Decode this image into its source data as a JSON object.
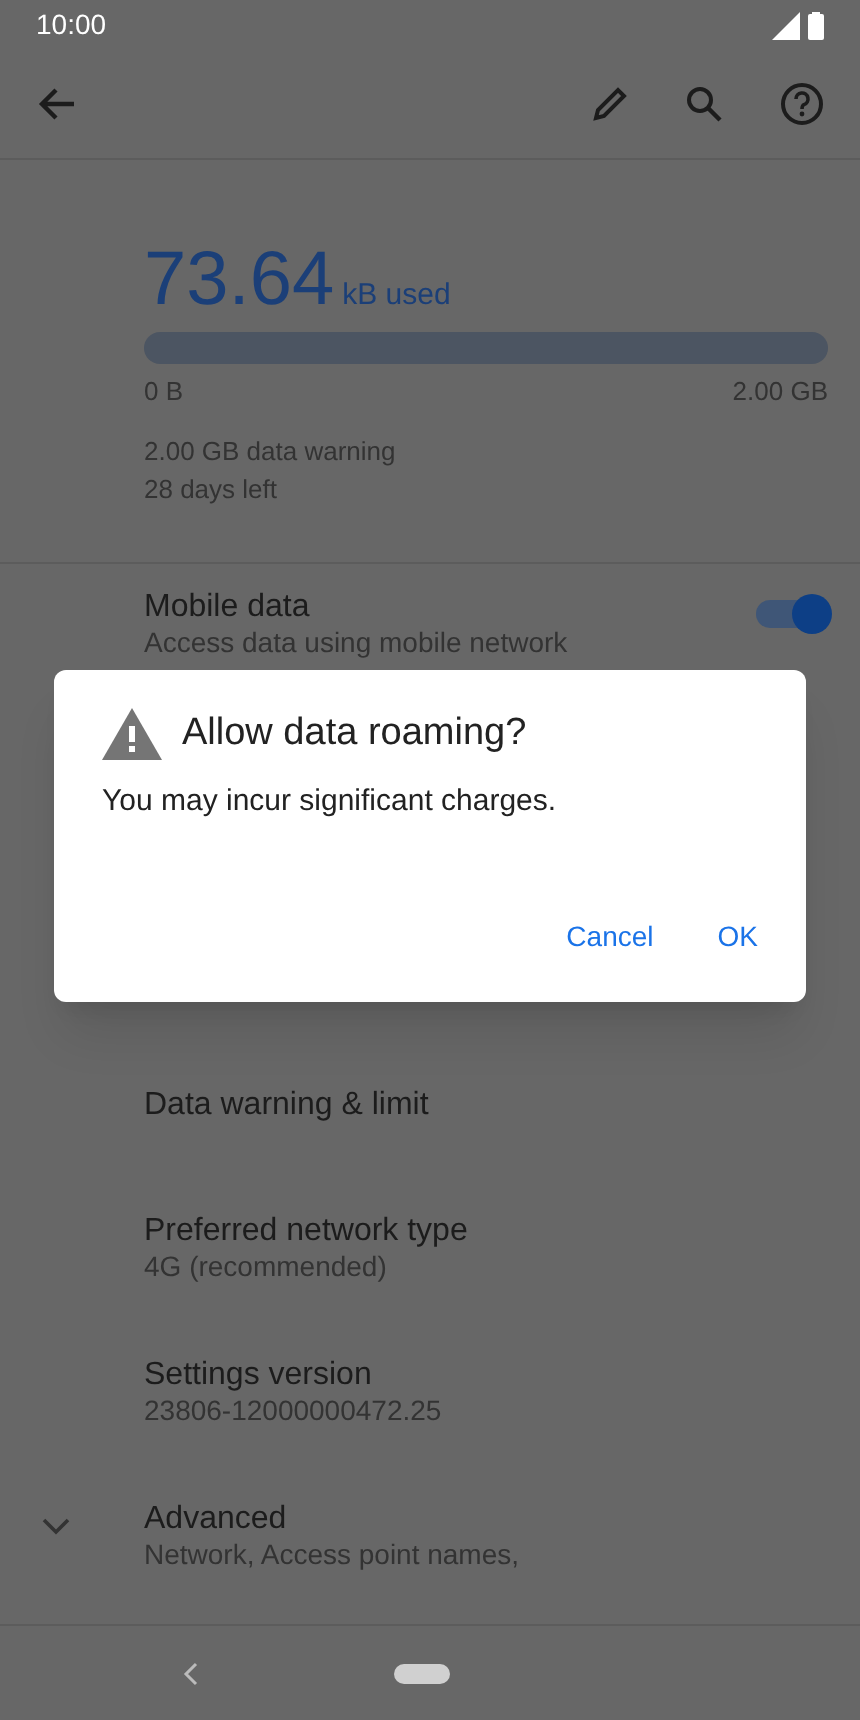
{
  "status_bar": {
    "time": "10:00"
  },
  "usage": {
    "amount": "73.64",
    "unit": "kB used",
    "min_label": "0 B",
    "max_label": "2.00 GB",
    "warning": "2.00 GB data warning",
    "days_left": "28 days left"
  },
  "settings": [
    {
      "kind": "toggle",
      "title": "Mobile data",
      "subtitle": "Access data using mobile network",
      "on": true
    },
    {
      "kind": "plain",
      "title": "Data warning & limit"
    },
    {
      "kind": "plain",
      "title": "Preferred network type",
      "subtitle": "4G (recommended)"
    },
    {
      "kind": "plain",
      "title": "Settings version",
      "subtitle": "23806-12000000472.25"
    },
    {
      "kind": "expander",
      "title": "Advanced",
      "subtitle": "Network, Access point names,",
      "expanded": false
    }
  ],
  "dialog": {
    "title": "Allow data roaming?",
    "message": "You may incur significant charges.",
    "buttons": [
      "Cancel",
      "OK"
    ]
  }
}
